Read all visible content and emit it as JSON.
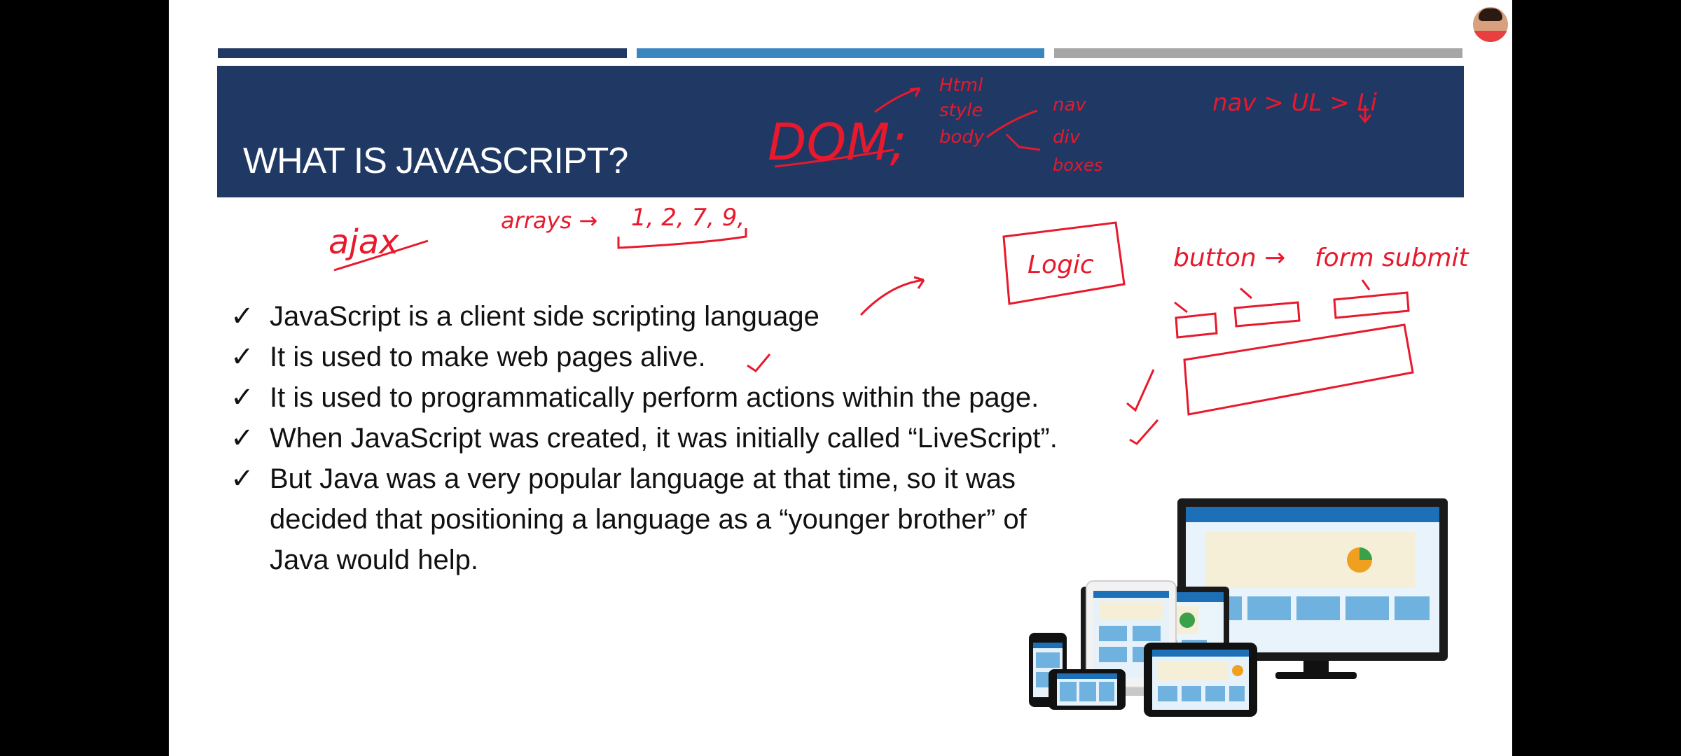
{
  "slide": {
    "title": "WHAT IS JAVASCRIPT?",
    "check_glyph": "✓",
    "bullets": [
      "JavaScript is a client side scripting language",
      "It is used to make web pages alive.",
      "It is used to programmatically perform actions within the page.",
      "When JavaScript was created, it was initially called “LiveScript”.",
      "But Java was a very popular language at that time, so it was decided that positioning a language as a “younger brother” of Java would help."
    ]
  },
  "annotations": {
    "dom": "DOM;",
    "dom_children": [
      "Html",
      "style",
      "body"
    ],
    "body_children": [
      "nav",
      "div",
      "boxes"
    ],
    "nav_path": "nav > UL > Li",
    "ajax": "ajax",
    "arrays": "arrays →",
    "array_values": "1, 2, 7, 9,",
    "logic": "Logic",
    "button": "button →",
    "form_submit": "form submit"
  },
  "colors": {
    "title_band": "#1f3864",
    "strip_dark": "#1f3864",
    "strip_mid": "#3a87c0",
    "strip_gray": "#a6a6a6",
    "annotation_ink": "#e8192c"
  },
  "illustration": "responsive-devices"
}
